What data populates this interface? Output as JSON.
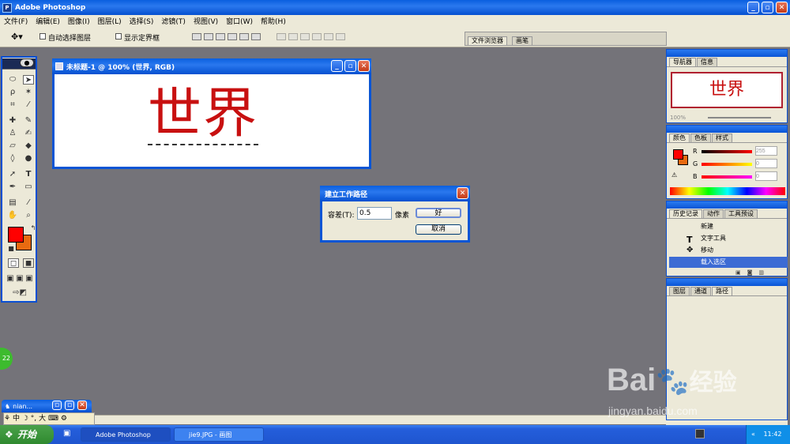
{
  "app": {
    "title": "Adobe Photoshop"
  },
  "menu": [
    "文件(F)",
    "编辑(E)",
    "图像(I)",
    "图层(L)",
    "选择(S)",
    "滤镜(T)",
    "视图(V)",
    "窗口(W)",
    "帮助(H)"
  ],
  "options": {
    "auto_select": "自动选择图层",
    "show_bounds": "显示定界框",
    "tabs": [
      "文件浏览器",
      "画笔"
    ]
  },
  "document": {
    "title": "未标题-1 @ 100% (世界, RGB)",
    "text": "世界",
    "text_color": "#c81010"
  },
  "dialog": {
    "title": "建立工作路径",
    "tolerance_label": "容差(T):",
    "tolerance_value": "0.5",
    "unit": "像素",
    "ok": "好",
    "cancel": "取消"
  },
  "navigator": {
    "tabs": [
      "导航器",
      "信息"
    ],
    "preview_text": "世界",
    "zoom": "100%"
  },
  "color": {
    "tabs": [
      "颜色",
      "色板",
      "样式"
    ],
    "r_label": "R",
    "g_label": "G",
    "b_label": "B",
    "r_value": "255",
    "g_value": "0",
    "b_value": "0",
    "foreground": "#ff0000",
    "background": "#e86a10"
  },
  "history": {
    "tabs": [
      "历史记录",
      "动作",
      "工具预设"
    ],
    "items": [
      "新建",
      "文字工具",
      "移动",
      "载入选区"
    ]
  },
  "layers": {
    "tabs": [
      "图层",
      "通道",
      "路径"
    ]
  },
  "minimized": {
    "title": "nian..."
  },
  "ime": {
    "items": [
      "中",
      "°,",
      "大"
    ]
  },
  "taskbar": {
    "start": "开始",
    "items": [
      "Adobe Photoshop",
      "jie9.JPG - 画图"
    ],
    "clock": "11:42"
  },
  "bubble": "22",
  "watermark": {
    "brand": "Bai",
    "brand2": "经验",
    "url": "jingyan.baidu.com"
  }
}
